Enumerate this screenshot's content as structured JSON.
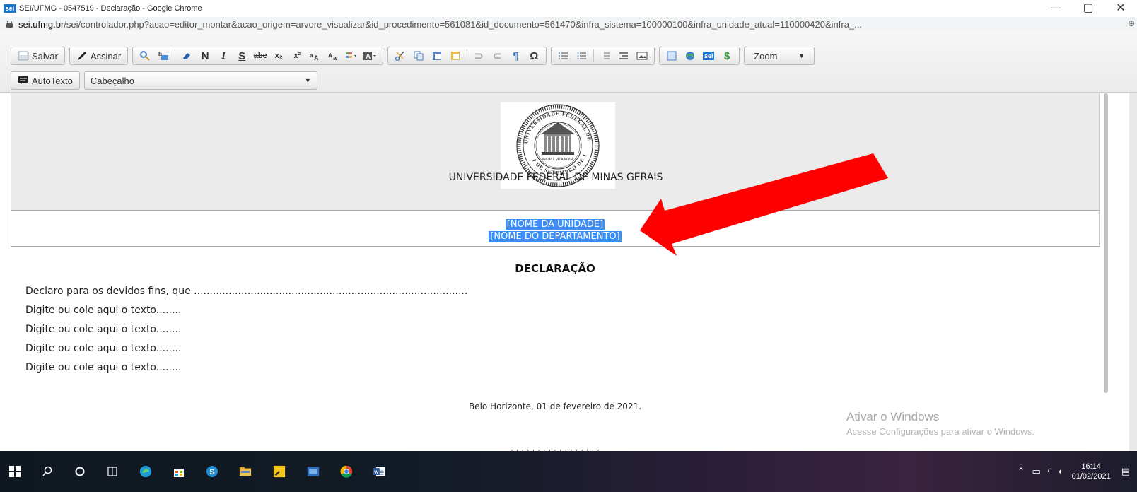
{
  "window": {
    "title": "SEI/UFMG - 0547519 - Declaração - Google Chrome",
    "logo_text": "sei",
    "minimize_glyph": "—",
    "restore_glyph": "▢",
    "close_glyph": "✕"
  },
  "address_bar": {
    "host": "sei.ufmg.br",
    "path": "/sei/controlador.php?acao=editor_montar&acao_origem=arvore_visualizar&id_procedimento=561081&id_documento=561470&infra_sistema=100000100&infra_unidade_atual=110000420&infra_...",
    "extension_glyph": "⊕"
  },
  "toolbar": {
    "save_label": "Salvar",
    "sign_label": "Assinar",
    "bold": "N",
    "italic": "I",
    "strike": "S",
    "strike2": "abc",
    "subscript": "x₂",
    "superscript": "x²",
    "omega": "Ω",
    "pilcrow": "¶",
    "zoom_label": "Zoom",
    "autotext_label": "AutoTexto",
    "style_select_value": "Cabeçalho",
    "sei_label": "sei",
    "dollar": "$"
  },
  "document": {
    "university": "UNIVERSIDADE FEDERAL DE MINAS GERAIS",
    "unit_placeholder": "[NOME DA UNIDADE]",
    "department_placeholder": "[NOME DO DEPARTAMENTO]",
    "title": "DECLARAÇÃO",
    "first_line": "Declaro para os devidos fins, que .......................................................................................",
    "body_lines": [
      "Digite ou cole aqui o texto........",
      "Digite ou cole aqui o texto........",
      "Digite ou cole aqui o texto........",
      "Digite ou cole aqui o texto........"
    ],
    "place_date": "Belo Horizonte, 01 de fevereiro de 2021."
  },
  "seal": {
    "ring_text_top": "UNIVERSIDADE FEDERAL DE MINAS GERAIS",
    "ring_text_bottom": "7 DE SETEMBRO DE 1927",
    "motto": "INCIPIT VITA NOVA"
  },
  "watermark": {
    "line1": "Ativar o Windows",
    "line2": "Acesse Configurações para ativar o Windows."
  },
  "taskbar": {
    "time": "16:14",
    "date": "01/02/2021"
  },
  "colors": {
    "selection": "#3a8ef6",
    "arrow": "#ff0000",
    "header_bg": "#ebebeb"
  }
}
